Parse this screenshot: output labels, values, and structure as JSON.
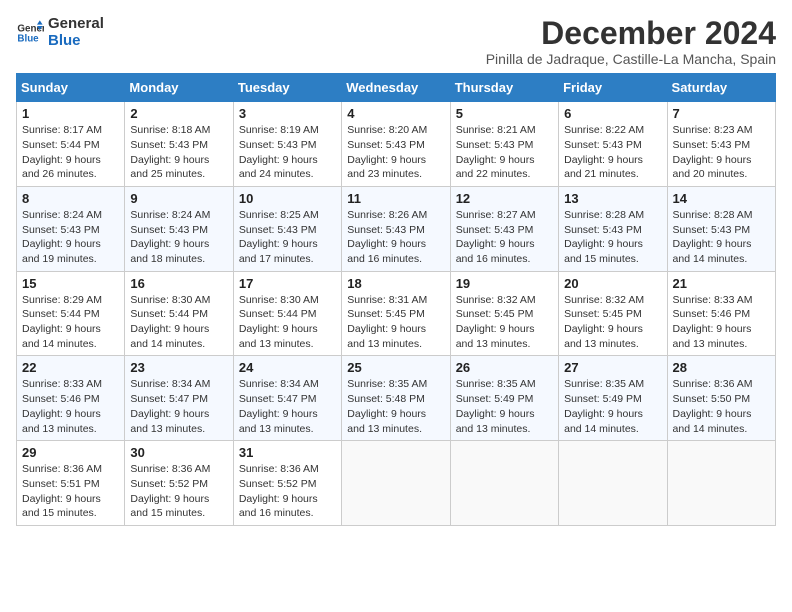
{
  "logo": {
    "line1": "General",
    "line2": "Blue"
  },
  "title": {
    "month_year": "December 2024",
    "location": "Pinilla de Jadraque, Castille-La Mancha, Spain"
  },
  "weekdays": [
    "Sunday",
    "Monday",
    "Tuesday",
    "Wednesday",
    "Thursday",
    "Friday",
    "Saturday"
  ],
  "weeks": [
    [
      {
        "day": "1",
        "sunrise": "8:17 AM",
        "sunset": "5:44 PM",
        "daylight": "9 hours and 26 minutes."
      },
      {
        "day": "2",
        "sunrise": "8:18 AM",
        "sunset": "5:43 PM",
        "daylight": "9 hours and 25 minutes."
      },
      {
        "day": "3",
        "sunrise": "8:19 AM",
        "sunset": "5:43 PM",
        "daylight": "9 hours and 24 minutes."
      },
      {
        "day": "4",
        "sunrise": "8:20 AM",
        "sunset": "5:43 PM",
        "daylight": "9 hours and 23 minutes."
      },
      {
        "day": "5",
        "sunrise": "8:21 AM",
        "sunset": "5:43 PM",
        "daylight": "9 hours and 22 minutes."
      },
      {
        "day": "6",
        "sunrise": "8:22 AM",
        "sunset": "5:43 PM",
        "daylight": "9 hours and 21 minutes."
      },
      {
        "day": "7",
        "sunrise": "8:23 AM",
        "sunset": "5:43 PM",
        "daylight": "9 hours and 20 minutes."
      }
    ],
    [
      {
        "day": "8",
        "sunrise": "8:24 AM",
        "sunset": "5:43 PM",
        "daylight": "9 hours and 19 minutes."
      },
      {
        "day": "9",
        "sunrise": "8:24 AM",
        "sunset": "5:43 PM",
        "daylight": "9 hours and 18 minutes."
      },
      {
        "day": "10",
        "sunrise": "8:25 AM",
        "sunset": "5:43 PM",
        "daylight": "9 hours and 17 minutes."
      },
      {
        "day": "11",
        "sunrise": "8:26 AM",
        "sunset": "5:43 PM",
        "daylight": "9 hours and 16 minutes."
      },
      {
        "day": "12",
        "sunrise": "8:27 AM",
        "sunset": "5:43 PM",
        "daylight": "9 hours and 16 minutes."
      },
      {
        "day": "13",
        "sunrise": "8:28 AM",
        "sunset": "5:43 PM",
        "daylight": "9 hours and 15 minutes."
      },
      {
        "day": "14",
        "sunrise": "8:28 AM",
        "sunset": "5:43 PM",
        "daylight": "9 hours and 14 minutes."
      }
    ],
    [
      {
        "day": "15",
        "sunrise": "8:29 AM",
        "sunset": "5:44 PM",
        "daylight": "9 hours and 14 minutes."
      },
      {
        "day": "16",
        "sunrise": "8:30 AM",
        "sunset": "5:44 PM",
        "daylight": "9 hours and 14 minutes."
      },
      {
        "day": "17",
        "sunrise": "8:30 AM",
        "sunset": "5:44 PM",
        "daylight": "9 hours and 13 minutes."
      },
      {
        "day": "18",
        "sunrise": "8:31 AM",
        "sunset": "5:45 PM",
        "daylight": "9 hours and 13 minutes."
      },
      {
        "day": "19",
        "sunrise": "8:32 AM",
        "sunset": "5:45 PM",
        "daylight": "9 hours and 13 minutes."
      },
      {
        "day": "20",
        "sunrise": "8:32 AM",
        "sunset": "5:45 PM",
        "daylight": "9 hours and 13 minutes."
      },
      {
        "day": "21",
        "sunrise": "8:33 AM",
        "sunset": "5:46 PM",
        "daylight": "9 hours and 13 minutes."
      }
    ],
    [
      {
        "day": "22",
        "sunrise": "8:33 AM",
        "sunset": "5:46 PM",
        "daylight": "9 hours and 13 minutes."
      },
      {
        "day": "23",
        "sunrise": "8:34 AM",
        "sunset": "5:47 PM",
        "daylight": "9 hours and 13 minutes."
      },
      {
        "day": "24",
        "sunrise": "8:34 AM",
        "sunset": "5:47 PM",
        "daylight": "9 hours and 13 minutes."
      },
      {
        "day": "25",
        "sunrise": "8:35 AM",
        "sunset": "5:48 PM",
        "daylight": "9 hours and 13 minutes."
      },
      {
        "day": "26",
        "sunrise": "8:35 AM",
        "sunset": "5:49 PM",
        "daylight": "9 hours and 13 minutes."
      },
      {
        "day": "27",
        "sunrise": "8:35 AM",
        "sunset": "5:49 PM",
        "daylight": "9 hours and 14 minutes."
      },
      {
        "day": "28",
        "sunrise": "8:36 AM",
        "sunset": "5:50 PM",
        "daylight": "9 hours and 14 minutes."
      }
    ],
    [
      {
        "day": "29",
        "sunrise": "8:36 AM",
        "sunset": "5:51 PM",
        "daylight": "9 hours and 15 minutes."
      },
      {
        "day": "30",
        "sunrise": "8:36 AM",
        "sunset": "5:52 PM",
        "daylight": "9 hours and 15 minutes."
      },
      {
        "day": "31",
        "sunrise": "8:36 AM",
        "sunset": "5:52 PM",
        "daylight": "9 hours and 16 minutes."
      },
      null,
      null,
      null,
      null
    ]
  ],
  "labels": {
    "sunrise": "Sunrise:",
    "sunset": "Sunset:",
    "daylight": "Daylight:"
  }
}
